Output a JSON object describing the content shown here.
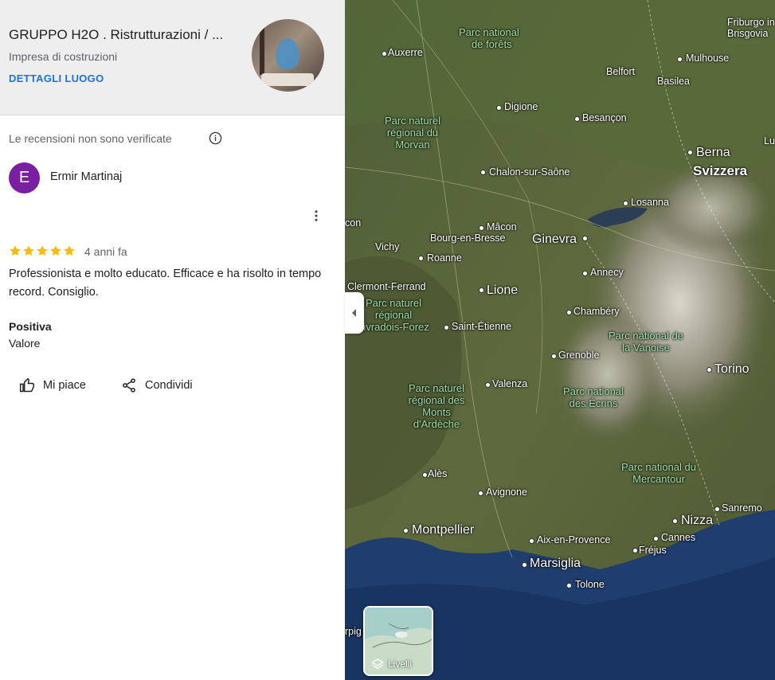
{
  "place": {
    "title": "GRUPPO H2O . Ristrutturazioni / ...",
    "category": "Impresa di costruzioni",
    "details_link": "DETTAGLI LUOGO"
  },
  "review": {
    "unverified_notice": "Le recensioni non sono verificate",
    "author_initial": "E",
    "author_name": "Ermir Martinaj",
    "avatar_color": "#7b1fa2",
    "rating": 5,
    "time_ago": "4 anni fa",
    "text": "Professionista e molto educato. Efficace e ha risolto in tempo record. Consiglio.",
    "positive_label": "Positiva",
    "positive_value": "Valore",
    "like_label": "Mi piace",
    "share_label": "Condividi"
  },
  "map": {
    "layers_label": "Livelli",
    "labels": {
      "friburgo": "Friburgo in",
      "brisgovia": "Brisgovia",
      "parc_forets_1": "Parc national",
      "parc_forets_2": "de forêts",
      "auxerre": "Auxerre",
      "mulhouse": "Mulhouse",
      "belfort": "Belfort",
      "basilea": "Basilea",
      "digione": "Digione",
      "besancon": "Besançon",
      "morvan": "Parc naturel régional du Morvan",
      "berna": "Berna",
      "svizzera": "Svizzera",
      "lu": "Lu",
      "chalon": "Chalon-sur-Saône",
      "losanna": "Losanna",
      "con": "con",
      "macon": "Mâcon",
      "bourg": "Bourg-en-Bresse",
      "ginevra": "Ginevra",
      "vichy": "Vichy",
      "roanne": "Roanne",
      "annecy": "Annecy",
      "clermont": "Clermont-Ferrand",
      "lione": "Lione",
      "livradois": "Parc naturel régional Livradois-Forez",
      "chambery": "Chambéry",
      "stetienne": "Saint-Étienne",
      "vanoise": "Parc national de la Vanoise",
      "grenoble": "Grenoble",
      "torino": "Torino",
      "valenza": "Valenza",
      "ardeche": "Parc naturel régional des Monts d'Ardèche",
      "ecrins": "Parc national des Écrins",
      "ales": "Alès",
      "mercantour": "Parc national du Mercantour",
      "avignone": "Avignone",
      "sanremo": "Sanremo",
      "nizza": "Nizza",
      "montpellier": "Montpellier",
      "cannes": "Cannes",
      "aix": "Aix-en-Provence",
      "frejus": "Fréjus",
      "marsiglia": "Marsiglia",
      "tolone": "Tolone",
      "rpig": "rpig"
    }
  }
}
